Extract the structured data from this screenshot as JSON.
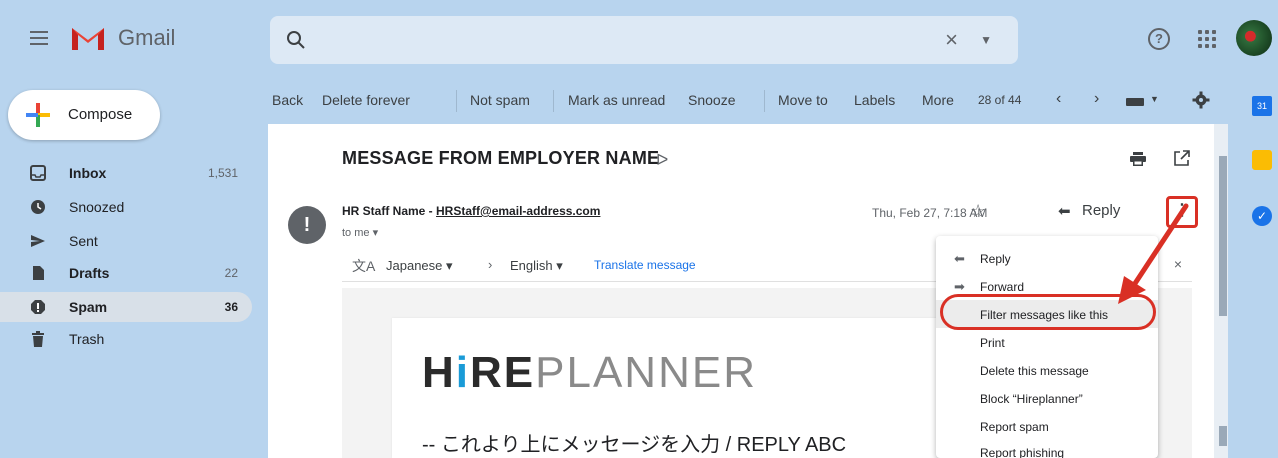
{
  "app": {
    "name": "Gmail"
  },
  "search": {
    "placeholder": "",
    "clear_glyph": "×",
    "options_glyph": "▼"
  },
  "compose": {
    "label": "Compose"
  },
  "sidebar": {
    "items": [
      {
        "label": "Inbox",
        "count": "1,531",
        "icon": "inbox-icon",
        "bold": true
      },
      {
        "label": "Snoozed",
        "count": "",
        "icon": "clock-icon",
        "bold": false
      },
      {
        "label": "Sent",
        "count": "",
        "icon": "send-icon",
        "bold": false
      },
      {
        "label": "Drafts",
        "count": "22",
        "icon": "draft-icon",
        "bold": true
      },
      {
        "label": "Spam",
        "count": "36",
        "icon": "spam-icon",
        "bold": true,
        "active": true
      },
      {
        "label": "Trash",
        "count": "",
        "icon": "trash-icon",
        "bold": false
      }
    ]
  },
  "toolbar": {
    "back": "Back",
    "delete_forever": "Delete forever",
    "not_spam": "Not spam",
    "mark_unread": "Mark as unread",
    "snooze": "Snooze",
    "move_to": "Move to",
    "labels": "Labels",
    "more": "More",
    "pager": "28 of 44"
  },
  "message": {
    "subject": "MESSAGE FROM EMPLOYER NAME",
    "sender_name": "HR Staff Name - ",
    "sender_email": "HRStaff@email-address.com",
    "to": "to me",
    "date": "Thu, Feb 27, 7:18 AM",
    "reply_label": "Reply"
  },
  "translate": {
    "from": "Japanese",
    "to": "English",
    "link": "Translate message"
  },
  "email_body": {
    "logo_hi": "H",
    "logo_i": "i",
    "logo_re": "RE",
    "logo_planner": "PLANNER",
    "reply_above_line": "-- これより上にメッセージを入力 / REPLY ABC"
  },
  "menu": {
    "items": [
      {
        "label": "Reply",
        "icon": "reply-icon"
      },
      {
        "label": "Forward",
        "icon": "forward-icon"
      },
      {
        "label": "Filter messages like this",
        "icon": ""
      },
      {
        "label": "Print",
        "icon": ""
      },
      {
        "label": "Delete this message",
        "icon": ""
      },
      {
        "label": "Block “Hireplanner”",
        "icon": ""
      },
      {
        "label": "Report spam",
        "icon": ""
      },
      {
        "label": "Report phishing",
        "icon": ""
      }
    ]
  },
  "right_panel": {
    "calendar_day": "31"
  },
  "colors": {
    "accent": "#1a73e8",
    "annotation_red": "#d93025",
    "background": "#b8d4ee"
  }
}
